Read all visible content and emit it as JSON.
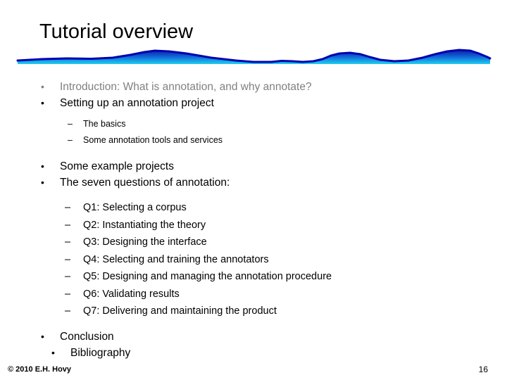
{
  "slide": {
    "title": "Tutorial overview",
    "page_number": "16",
    "copyright": "© 2010  E.H. Hovy",
    "decoration": {
      "name": "wave-divider",
      "outline_color": "#0000A0",
      "fill_top_color": "#0D1F9E",
      "fill_bottom_color": "#18C8E8"
    },
    "outline": [
      {
        "level": 1,
        "marker": "•",
        "text": "Introduction: What is annotation, and why annotate?",
        "state": "dimmed",
        "color": "#808080"
      },
      {
        "level": 1,
        "marker": "•",
        "text": "Setting up an annotation project",
        "state": "normal",
        "color": "#000000"
      },
      {
        "level": 2,
        "marker": "–",
        "text": "The basics",
        "state": "normal",
        "color": "#000000"
      },
      {
        "level": 2,
        "marker": "–",
        "text": "Some annotation tools and services",
        "state": "normal",
        "color": "#000000"
      },
      {
        "level": 1,
        "marker": "•",
        "text": "Some example projects",
        "state": "normal",
        "color": "#000000"
      },
      {
        "level": 1,
        "marker": "•",
        "text": "The seven questions of annotation:",
        "state": "normal",
        "color": "#000000"
      },
      {
        "level": 2,
        "marker": "–",
        "text": "Q1: Selecting a corpus",
        "state": "normal",
        "color": "#000000"
      },
      {
        "level": 2,
        "marker": "–",
        "text": "Q2: Instantiating the theory",
        "state": "normal",
        "color": "#000000"
      },
      {
        "level": 2,
        "marker": "–",
        "text": "Q3: Designing the interface",
        "state": "normal",
        "color": "#000000"
      },
      {
        "level": 2,
        "marker": "–",
        "text": "Q4: Selecting and training the annotators",
        "state": "normal",
        "color": "#000000"
      },
      {
        "level": 2,
        "marker": "–",
        "text": "Q5: Designing and managing the annotation procedure",
        "state": "normal",
        "color": "#000000"
      },
      {
        "level": 2,
        "marker": "–",
        "text": "Q6: Validating results",
        "state": "normal",
        "color": "#000000"
      },
      {
        "level": 2,
        "marker": "–",
        "text": "Q7: Delivering and maintaining the product",
        "state": "normal",
        "color": "#000000"
      },
      {
        "level": 1,
        "marker": "•",
        "text": "Conclusion",
        "state": "normal",
        "color": "#000000"
      },
      {
        "level": 1,
        "marker": "•",
        "text": "Bibliography",
        "state": "normal",
        "color": "#000000"
      }
    ]
  }
}
